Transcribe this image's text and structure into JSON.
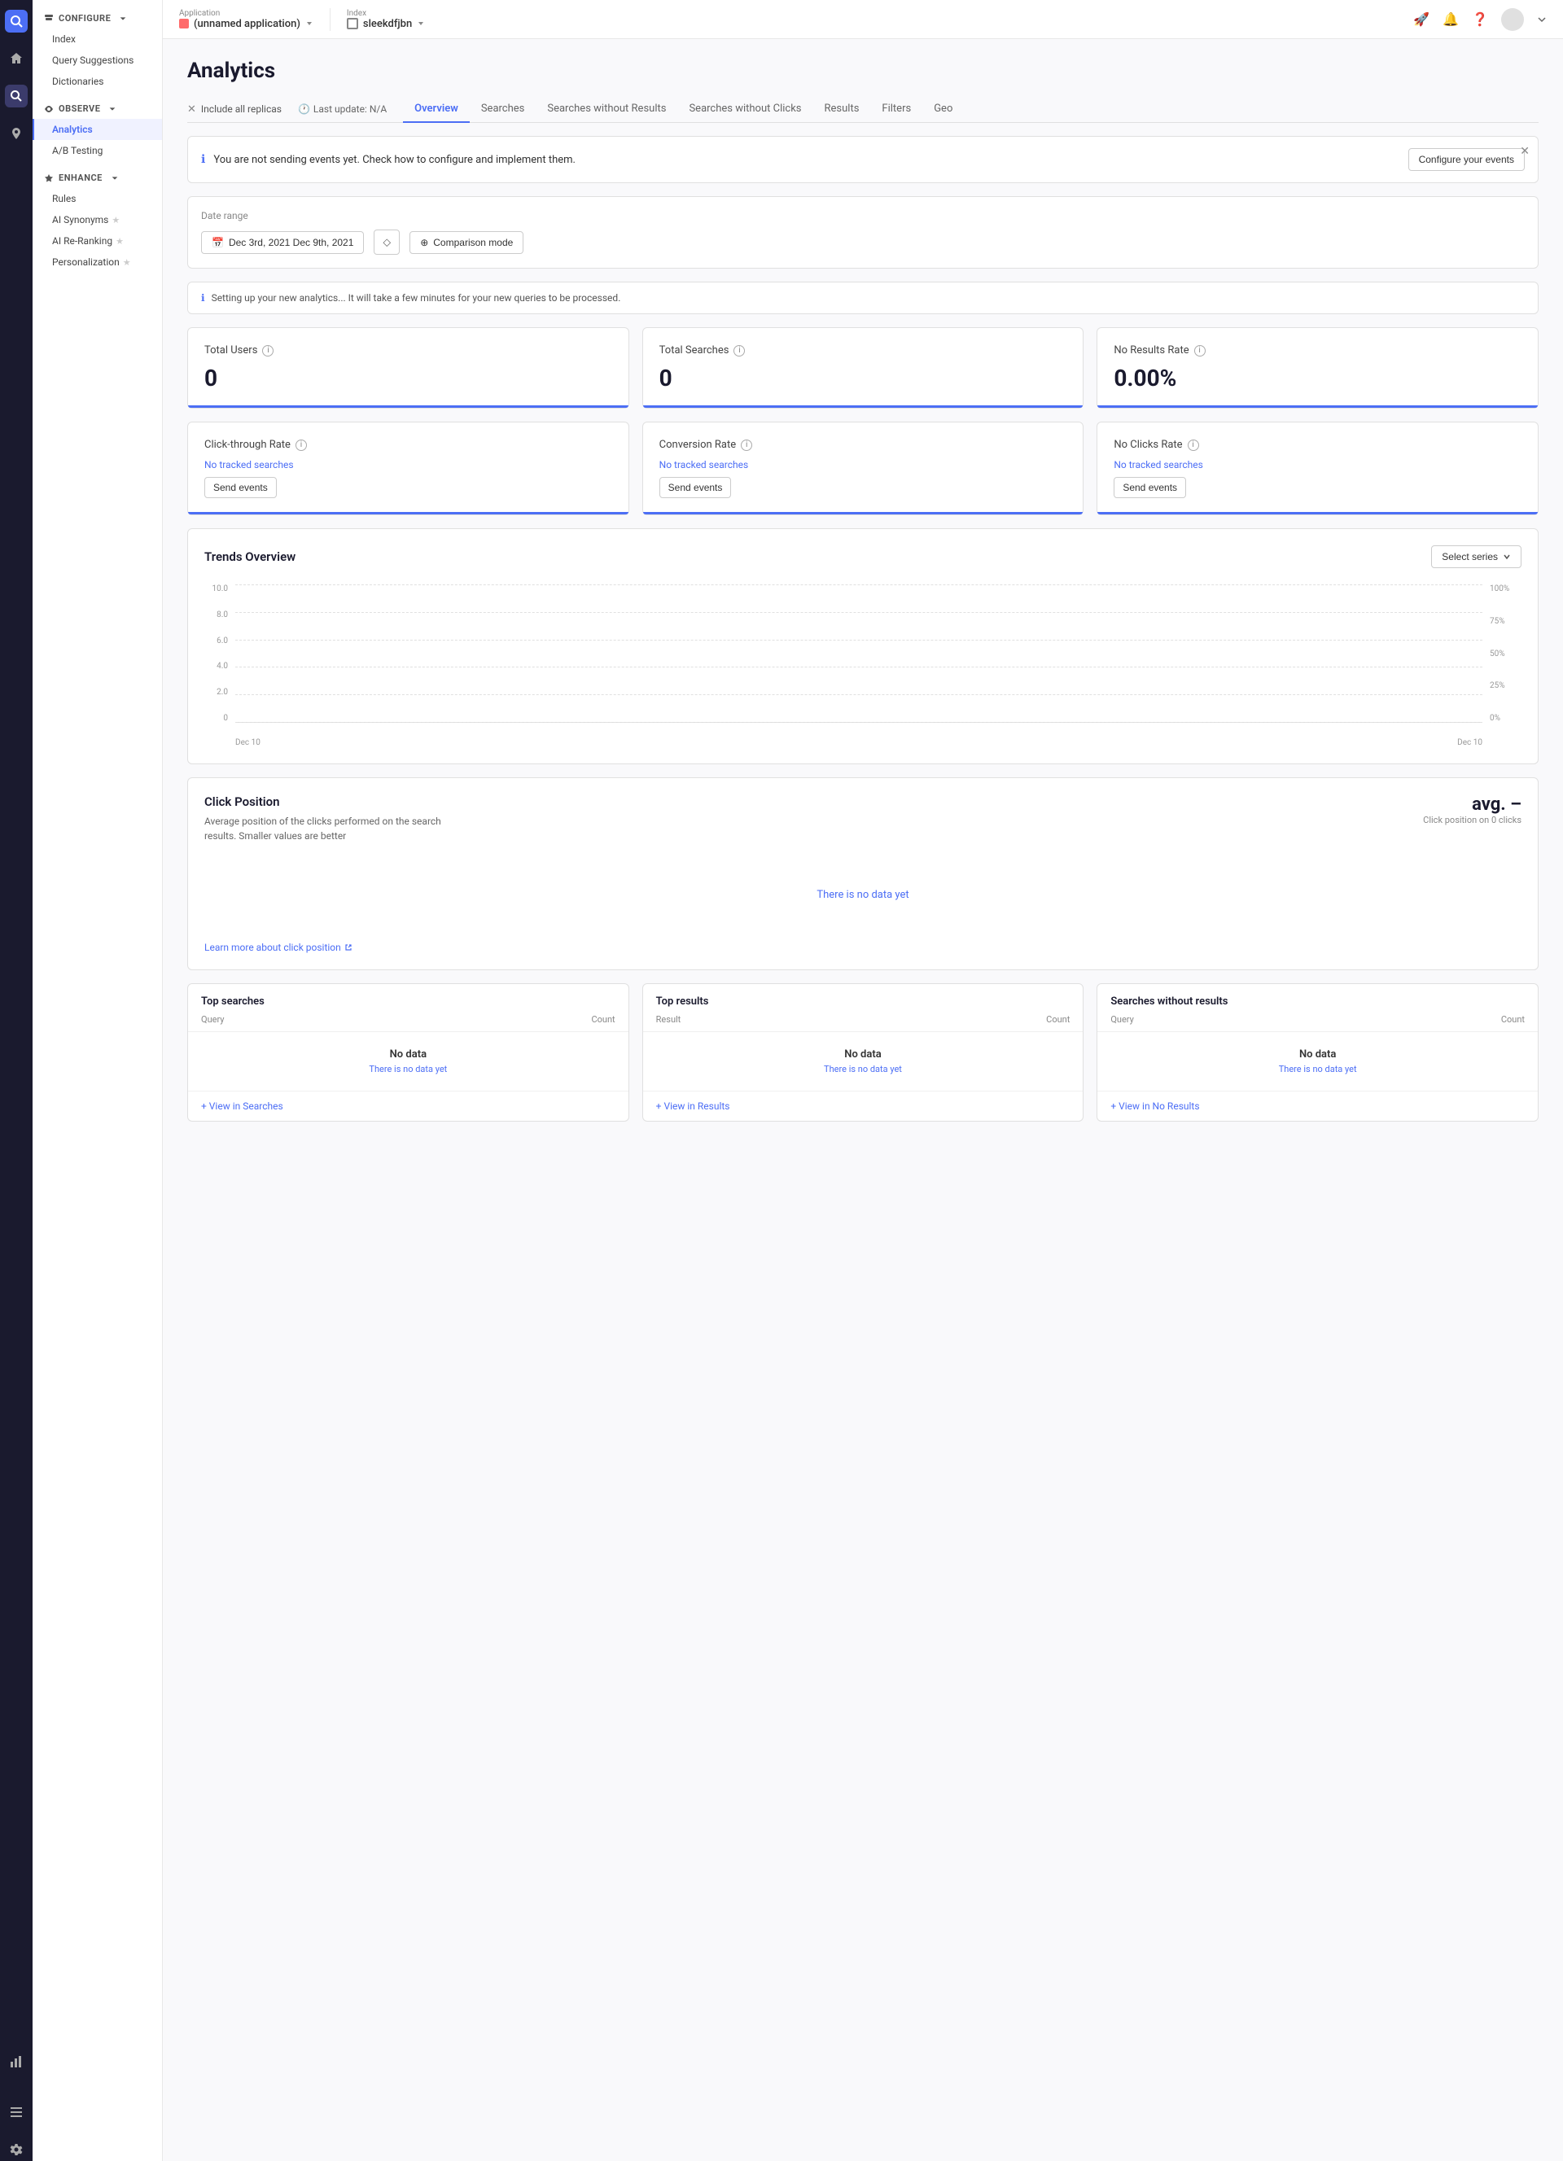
{
  "app": {
    "name": "(unnamed application)",
    "index": "sleekdfjbn"
  },
  "topbar": {
    "application_label": "Application",
    "index_label": "Index",
    "icons": [
      "rocket-icon",
      "bell-icon",
      "help-icon"
    ]
  },
  "sidebar": {
    "configure_label": "CONFIGURE",
    "configure_items": [
      "Index",
      "Query Suggestions",
      "Dictionaries"
    ],
    "observe_label": "OBSERVE",
    "observe_items": [
      "Analytics",
      "A/B Testing"
    ],
    "enhance_label": "ENHANCE",
    "enhance_items": [
      "Rules",
      "AI Synonyms",
      "AI Re-Ranking",
      "Personalization"
    ]
  },
  "page": {
    "title": "Analytics",
    "tabs": [
      "Overview",
      "Searches",
      "Searches without Results",
      "Searches without Clicks",
      "Results",
      "Filters",
      "Geo"
    ]
  },
  "filter_bar": {
    "include_replicas": "Include all replicas",
    "last_update": "Last update: N/A"
  },
  "alert": {
    "text": "You are not sending events yet. Check how to configure and implement them.",
    "button": "Configure your events"
  },
  "date_range": {
    "label": "Date range",
    "value": "Dec 3rd, 2021  Dec 9th, 2021",
    "comparison_label": "Comparison mode"
  },
  "setup_info": {
    "text": "Setting up your new analytics... It will take a few minutes for your new queries to be processed."
  },
  "metrics": [
    {
      "title": "Total Users",
      "value": "0",
      "type": "number"
    },
    {
      "title": "Total Searches",
      "value": "0",
      "type": "number"
    },
    {
      "title": "No Results Rate",
      "value": "0.00%",
      "type": "number"
    }
  ],
  "metrics2": [
    {
      "title": "Click-through Rate",
      "no_tracked": "No tracked searches",
      "btn": "Send events"
    },
    {
      "title": "Conversion Rate",
      "no_tracked": "No tracked searches",
      "btn": "Send events"
    },
    {
      "title": "No Clicks Rate",
      "no_tracked": "No tracked searches",
      "btn": "Send events"
    }
  ],
  "trends": {
    "title": "Trends Overview",
    "select_series": "Select series",
    "y_left": [
      "10.0",
      "8.0",
      "6.0",
      "4.0",
      "2.0",
      "0"
    ],
    "y_right": [
      "100%",
      "75%",
      "50%",
      "25%",
      "0%"
    ],
    "x": [
      "Dec 10",
      "Dec 10"
    ]
  },
  "click_position": {
    "title": "Click Position",
    "desc": "Average position of the clicks performed on the search results. Smaller values are better",
    "avg_label": "avg. –",
    "avg_sub": "Click position on 0 clicks",
    "empty_text": "There is no data yet",
    "link": "Learn more about click position"
  },
  "top_tables": [
    {
      "title": "Top searches",
      "col1": "Query",
      "col2": "Count",
      "empty_title": "No data",
      "empty_sub": "There is no data yet",
      "view_link": "+ View in Searches"
    },
    {
      "title": "Top results",
      "col1": "Result",
      "col2": "Count",
      "empty_title": "No data",
      "empty_sub": "There is no data yet",
      "view_link": "+ View in Results"
    },
    {
      "title": "Searches without results",
      "col1": "Query",
      "col2": "Count",
      "empty_title": "No data",
      "empty_sub": "There is no data yet",
      "view_link": "+ View in No Results"
    }
  ]
}
